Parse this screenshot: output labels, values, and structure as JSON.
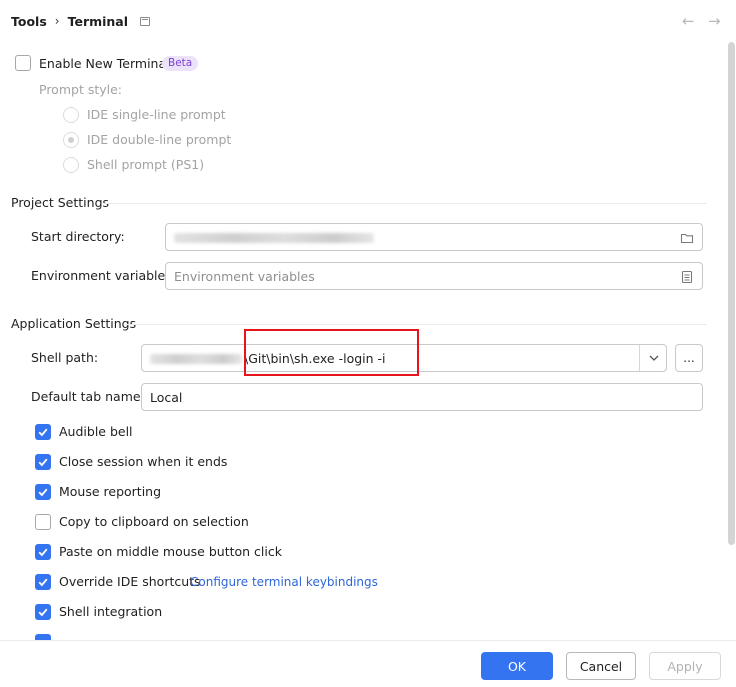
{
  "breadcrumb": {
    "parent": "Tools",
    "separator": "›",
    "current": "Terminal"
  },
  "nav": {
    "back": "←",
    "forward": "→"
  },
  "enable_new_terminal": {
    "label": "Enable New Terminal",
    "badge": "Beta",
    "checked": false
  },
  "prompt_style": {
    "label": "Prompt style:",
    "options": [
      {
        "label": "IDE single-line prompt",
        "selected": false
      },
      {
        "label": "IDE double-line prompt",
        "selected": true
      },
      {
        "label": "Shell prompt (PS1)",
        "selected": false
      }
    ]
  },
  "project_settings": {
    "title": "Project Settings",
    "start_directory": {
      "label": "Start directory:"
    },
    "environment_variables": {
      "label": "Environment variables:",
      "placeholder": "Environment variables"
    }
  },
  "application_settings": {
    "title": "Application Settings",
    "shell_path": {
      "label": "Shell path:",
      "visible_value": "\\Git\\bin\\sh.exe -login -i",
      "browse_label": "..."
    },
    "default_tab_name": {
      "label": "Default tab name:",
      "value": "Local"
    },
    "options": [
      {
        "label": "Audible bell",
        "checked": true
      },
      {
        "label": "Close session when it ends",
        "checked": true
      },
      {
        "label": "Mouse reporting",
        "checked": true
      },
      {
        "label": "Copy to clipboard on selection",
        "checked": false
      },
      {
        "label": "Paste on middle mouse button click",
        "checked": true
      },
      {
        "label": "Override IDE shortcuts",
        "checked": true,
        "link": "Configure terminal keybindings"
      },
      {
        "label": "Shell integration",
        "checked": true
      }
    ]
  },
  "footer": {
    "ok": "OK",
    "cancel": "Cancel",
    "apply": "Apply"
  },
  "colors": {
    "accent": "#3574f0",
    "highlight_box": "#e8141c",
    "beta_badge_bg": "#ece3fb",
    "beta_badge_text": "#7a3fd0"
  }
}
